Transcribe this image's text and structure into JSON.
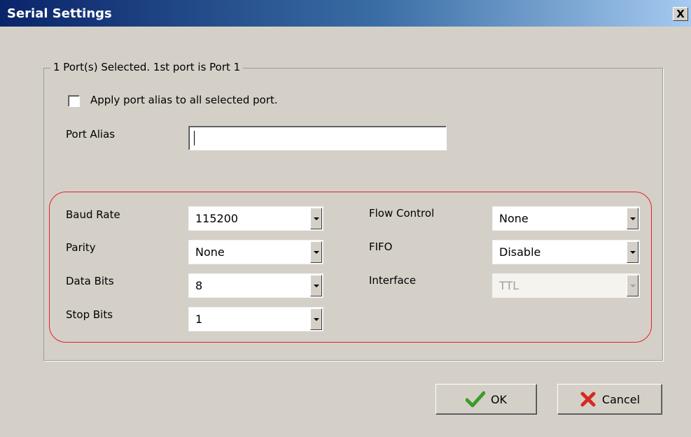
{
  "window": {
    "title": "Serial Settings",
    "close_symbol": "X"
  },
  "port_group": {
    "legend": "1 Port(s) Selected. 1st port is Port 1",
    "apply_alias_label": "Apply port alias to all selected port.",
    "apply_alias_checked": false,
    "port_alias_label": "Port Alias",
    "port_alias_value": ""
  },
  "serial": {
    "baud_rate_label": "Baud Rate",
    "baud_rate_value": "115200",
    "parity_label": "Parity",
    "parity_value": "None",
    "data_bits_label": "Data Bits",
    "data_bits_value": "8",
    "stop_bits_label": "Stop Bits",
    "stop_bits_value": "1",
    "flow_control_label": "Flow Control",
    "flow_control_value": "None",
    "fifo_label": "FIFO",
    "fifo_value": "Disable",
    "interface_label": "Interface",
    "interface_value": "TTL"
  },
  "buttons": {
    "ok_label": "OK",
    "cancel_label": "Cancel"
  },
  "colors": {
    "highlight_outline": "#e41e26",
    "ok_check": "#3f9b2a",
    "cancel_x": "#d32b1e"
  },
  "icons": {
    "ok": "check-icon",
    "cancel": "x-mark-icon"
  }
}
